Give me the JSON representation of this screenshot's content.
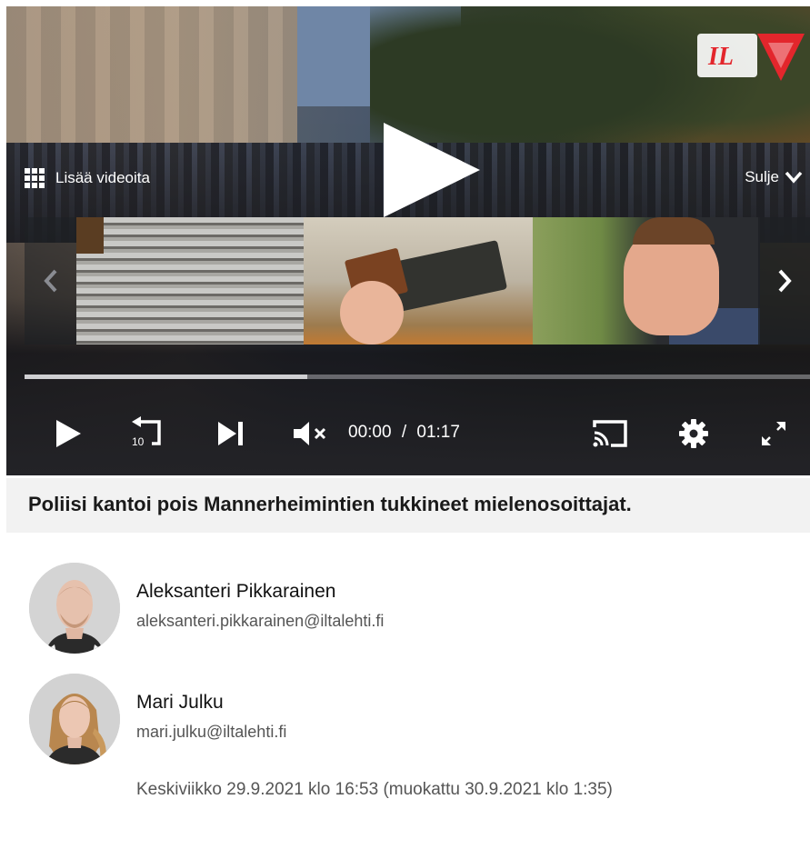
{
  "player": {
    "logo_text": "IL",
    "more_videos_label": "Lisää videoita",
    "close_label": "Sulje",
    "progress_fraction": 0.36,
    "current_time": "00:00",
    "time_separator": "/",
    "duration": "01:17",
    "replay_seconds": "10"
  },
  "caption": {
    "text": "Poliisi kantoi pois Mannerheimintien tukkineet mielenosoittajat."
  },
  "authors": [
    {
      "name": "Aleksanteri Pikkarainen",
      "email": "aleksanteri.pikkarainen@iltalehti.fi"
    },
    {
      "name": "Mari Julku",
      "email": "mari.julku@iltalehti.fi"
    }
  ],
  "timestamp": "Keskiviikko 29.9.2021 klo 16:53 (muokattu 30.9.2021 klo 1:35)",
  "colors": {
    "logo_red": "#e3262c",
    "control_bar": "#232327",
    "caption_bg": "#f2f2f2"
  }
}
